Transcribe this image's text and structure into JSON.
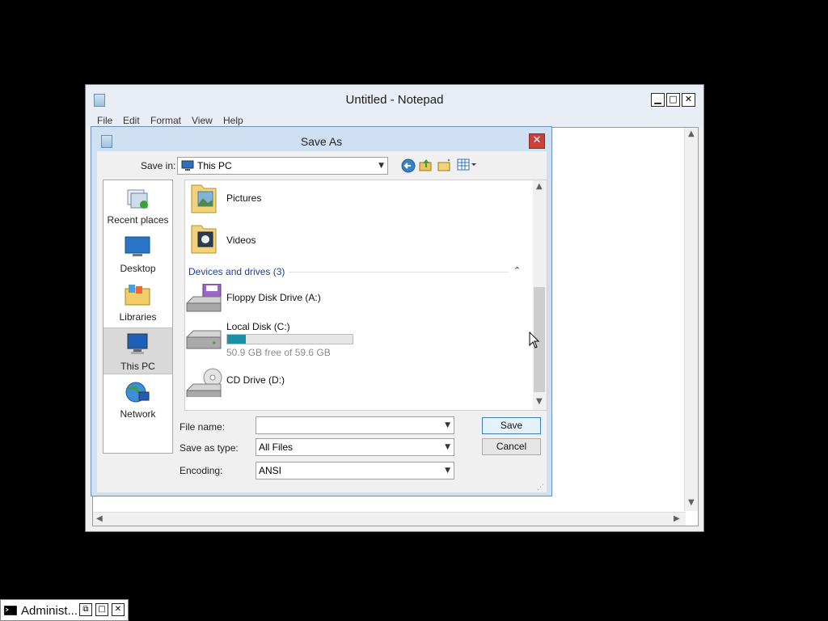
{
  "notepad": {
    "title": "Untitled - Notepad",
    "menu": [
      "File",
      "Edit",
      "Format",
      "View",
      "Help"
    ],
    "caption": {
      "minimize": "▁",
      "maximize": "□",
      "close": "✕"
    }
  },
  "dialog": {
    "title": "Save As",
    "close": "✕",
    "save_in_label": "Save in:",
    "save_in_value": "This PC",
    "places": [
      "Recent places",
      "Desktop",
      "Libraries",
      "This PC",
      "Network"
    ],
    "files": {
      "folders": [
        "Pictures",
        "Videos"
      ],
      "group_header": "Devices and drives (3)",
      "drives": [
        {
          "name": "Floppy Disk Drive (A:)"
        },
        {
          "name": "Local Disk (C:)",
          "free_text": "50.9 GB free of 59.6 GB",
          "used_fraction": 0.146
        },
        {
          "name": "CD Drive (D:)"
        }
      ]
    },
    "file_name_label": "File name:",
    "file_name_value": "",
    "save_as_type_label": "Save as type:",
    "save_as_type_value": "All Files",
    "encoding_label": "Encoding:",
    "encoding_value": "ANSI",
    "save_button": "Save",
    "cancel_button": "Cancel"
  },
  "taskbar": {
    "label": "Administ...",
    "restore": "⧉",
    "maximize": "□",
    "close": "✕"
  },
  "colors": {
    "accent": "#1a8fa8",
    "dialog_frame": "#cfe0f2",
    "close_red": "#c9423a",
    "group_header": "#1e3f91"
  }
}
